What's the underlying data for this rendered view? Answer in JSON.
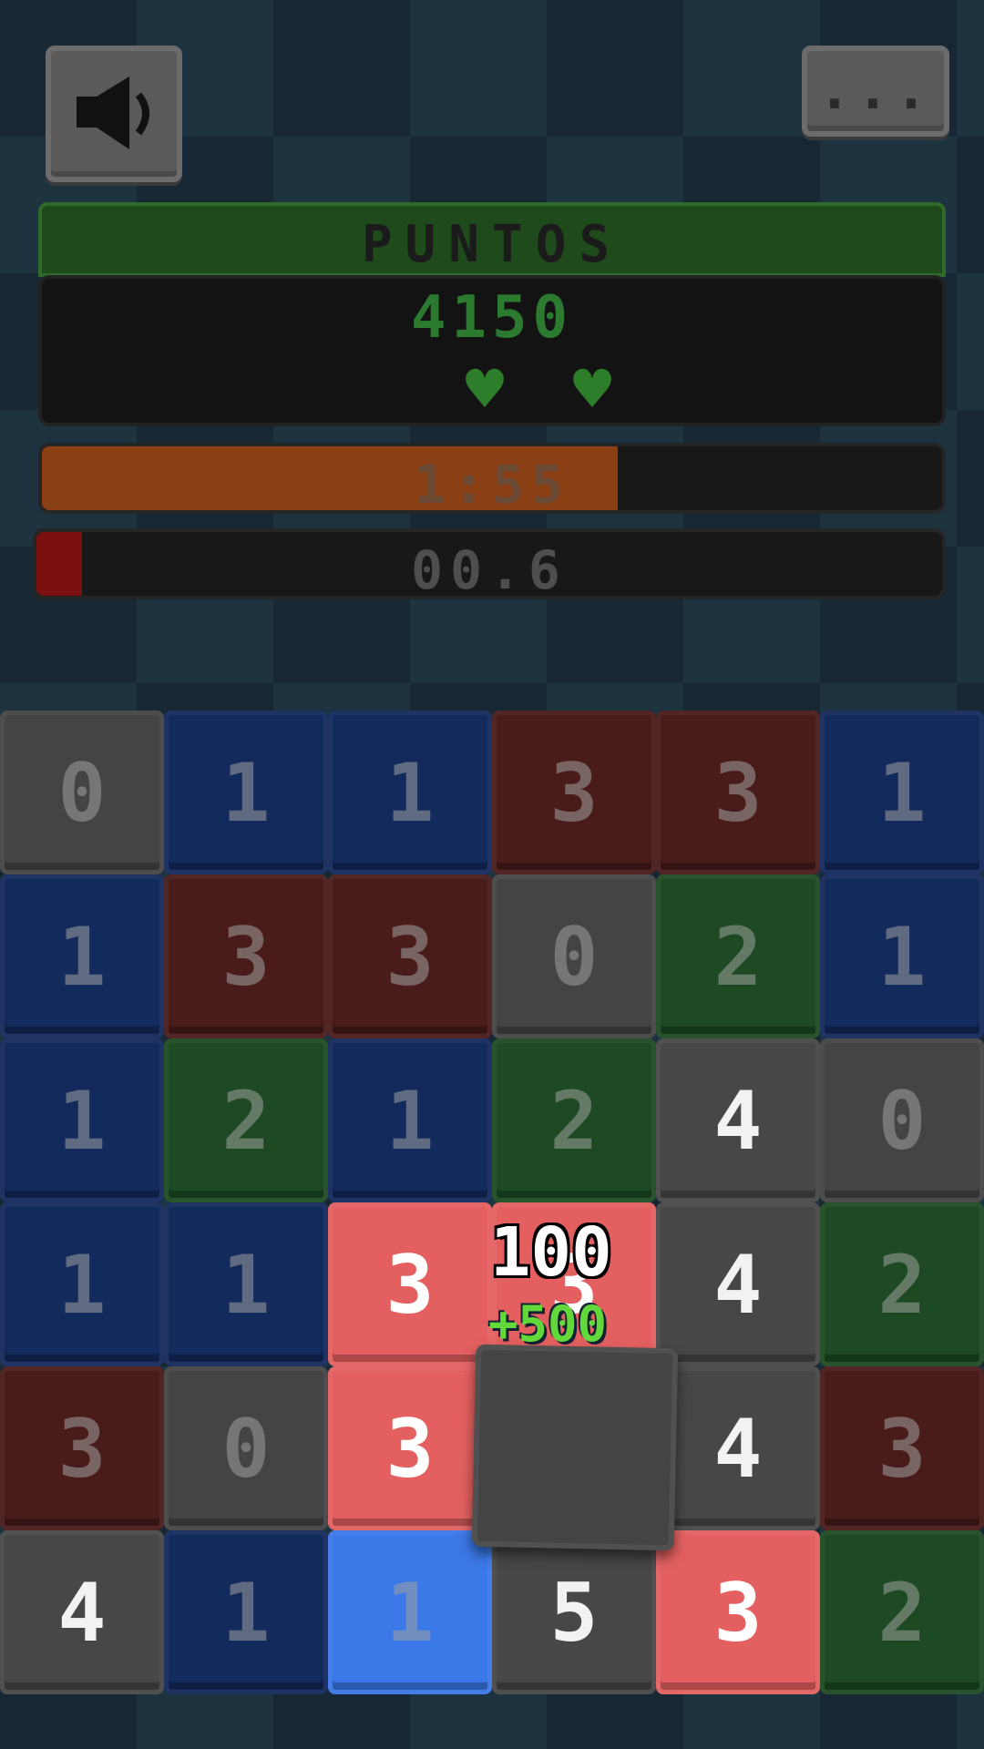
{
  "sound_button": {
    "icon": "speaker-icon"
  },
  "menu_button": {
    "label": "...",
    "icon": "more-icon"
  },
  "score": {
    "header": "PUNTOS",
    "value": "4150",
    "lives": 2,
    "life_icon": "heart-icon",
    "accent": "#2e7d2b"
  },
  "timer": {
    "text": "1:55",
    "fill_fraction": 0.64,
    "color": "#8a3f14"
  },
  "combo": {
    "text": "00.6",
    "fill_fraction": 0.05,
    "color": "#7a1010"
  },
  "colors": {
    "gray": "#444444",
    "blue": "#132a5c",
    "red": "#4a1b1b",
    "green": "#1d4a22"
  },
  "grid": {
    "rows": [
      [
        {
          "v": "0",
          "c": "gray"
        },
        {
          "v": "1",
          "c": "blue"
        },
        {
          "v": "1",
          "c": "blue"
        },
        {
          "v": "3",
          "c": "red"
        },
        {
          "v": "3",
          "c": "red"
        },
        {
          "v": "1",
          "c": "blue"
        }
      ],
      [
        {
          "v": "1",
          "c": "blue"
        },
        {
          "v": "3",
          "c": "red"
        },
        {
          "v": "3",
          "c": "red"
        },
        {
          "v": "0",
          "c": "gray"
        },
        {
          "v": "2",
          "c": "green"
        },
        {
          "v": "1",
          "c": "blue"
        }
      ],
      [
        {
          "v": "1",
          "c": "blue"
        },
        {
          "v": "2",
          "c": "green"
        },
        {
          "v": "1",
          "c": "blue"
        },
        {
          "v": "2",
          "c": "green"
        },
        {
          "v": "4",
          "c": "gray",
          "hl": true
        },
        {
          "v": "0",
          "c": "gray"
        }
      ],
      [
        {
          "v": "1",
          "c": "blue"
        },
        {
          "v": "1",
          "c": "blue"
        },
        {
          "v": "3",
          "c": "red",
          "lit": true
        },
        {
          "v": "3",
          "c": "red",
          "lit": true
        },
        {
          "v": "4",
          "c": "gray",
          "hl": true
        },
        {
          "v": "2",
          "c": "green"
        }
      ],
      [
        {
          "v": "3",
          "c": "red"
        },
        {
          "v": "0",
          "c": "gray"
        },
        {
          "v": "3",
          "c": "red",
          "lit": true,
          "hl": true
        },
        {
          "v": "",
          "c": "gray"
        },
        {
          "v": "4",
          "c": "gray",
          "hl": true
        },
        {
          "v": "3",
          "c": "red"
        }
      ],
      [
        {
          "v": "4",
          "c": "gray",
          "hl": true
        },
        {
          "v": "1",
          "c": "blue"
        },
        {
          "v": "1",
          "c": "blue",
          "lit": true
        },
        {
          "v": "5",
          "c": "gray",
          "hl": true
        },
        {
          "v": "3",
          "c": "red",
          "lit": true
        },
        {
          "v": "2",
          "c": "green"
        }
      ]
    ]
  },
  "popup": {
    "points": "100",
    "bonus": "+500"
  }
}
